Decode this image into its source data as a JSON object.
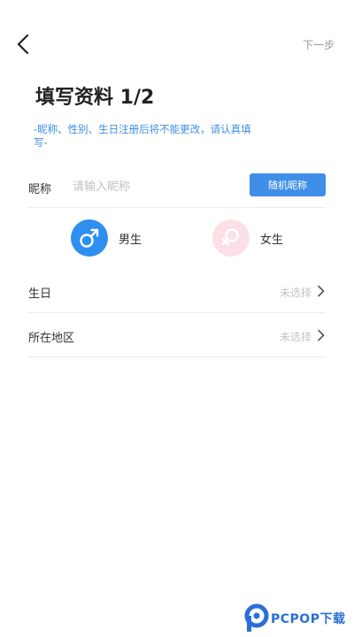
{
  "header": {
    "back_icon": "chevron-left-icon",
    "next_label": "下一步"
  },
  "title": "填写资料 1/2",
  "notice": "-昵称、性别、生日注册后将不能更改，请认真填写-",
  "nickname": {
    "label": "昵称",
    "placeholder": "请输入昵称",
    "value": "",
    "random_button": "随机昵称"
  },
  "gender": {
    "male": {
      "label": "男生",
      "icon": "male-symbol-icon",
      "color": "#2f8ff0"
    },
    "female": {
      "label": "女生",
      "icon": "female-symbol-icon",
      "color": "#fbe1e6"
    }
  },
  "birthday": {
    "label": "生日",
    "value": "未选择"
  },
  "region": {
    "label": "所在地区",
    "value": "未选择"
  },
  "watermark": {
    "text": "PCPOP下载",
    "icon": "pcpop-logo-icon"
  },
  "colors": {
    "accent": "#3f8ee8",
    "notice": "#3d8ee6"
  }
}
